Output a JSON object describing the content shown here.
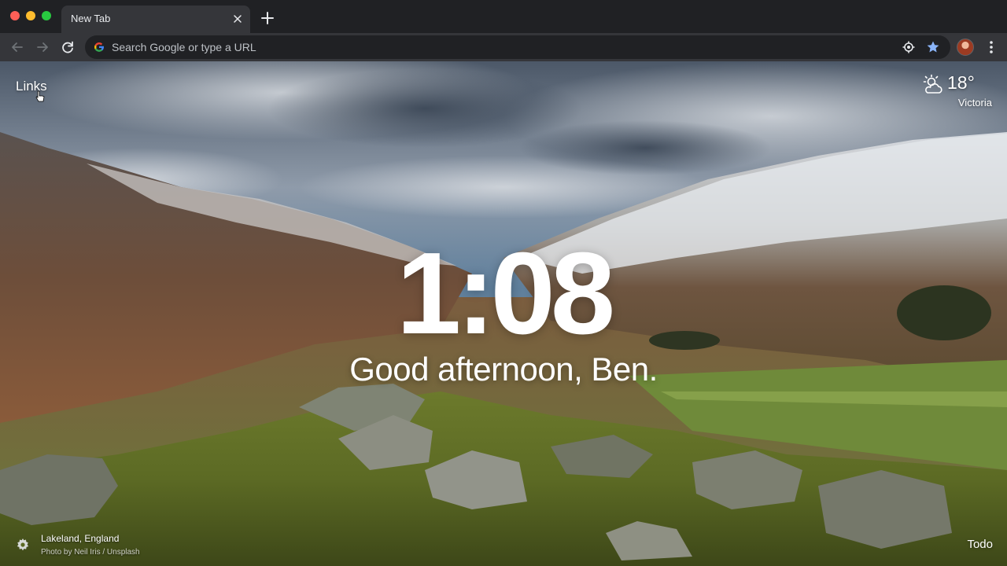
{
  "browser": {
    "tab": {
      "title": "New Tab"
    },
    "omnibox": {
      "placeholder": "Search Google or type a URL"
    }
  },
  "page": {
    "links_label": "Links",
    "weather": {
      "temperature": "18°",
      "location": "Victoria"
    },
    "clock": "1:08",
    "greeting": "Good afternoon, Ben.",
    "photo": {
      "location": "Lakeland, England",
      "credit": "Photo by Neil Iris / Unsplash"
    },
    "todo_label": "Todo"
  },
  "colors": {
    "toolbar": "#35363a",
    "titlebar": "#202124",
    "bookmark_star": "#8ab4f8"
  },
  "icons": [
    "back-icon",
    "forward-icon",
    "reload-icon",
    "google-icon",
    "location-icon",
    "star-icon",
    "kebab-menu-icon",
    "partly-cloudy-icon",
    "gear-icon",
    "close-icon",
    "plus-icon"
  ]
}
